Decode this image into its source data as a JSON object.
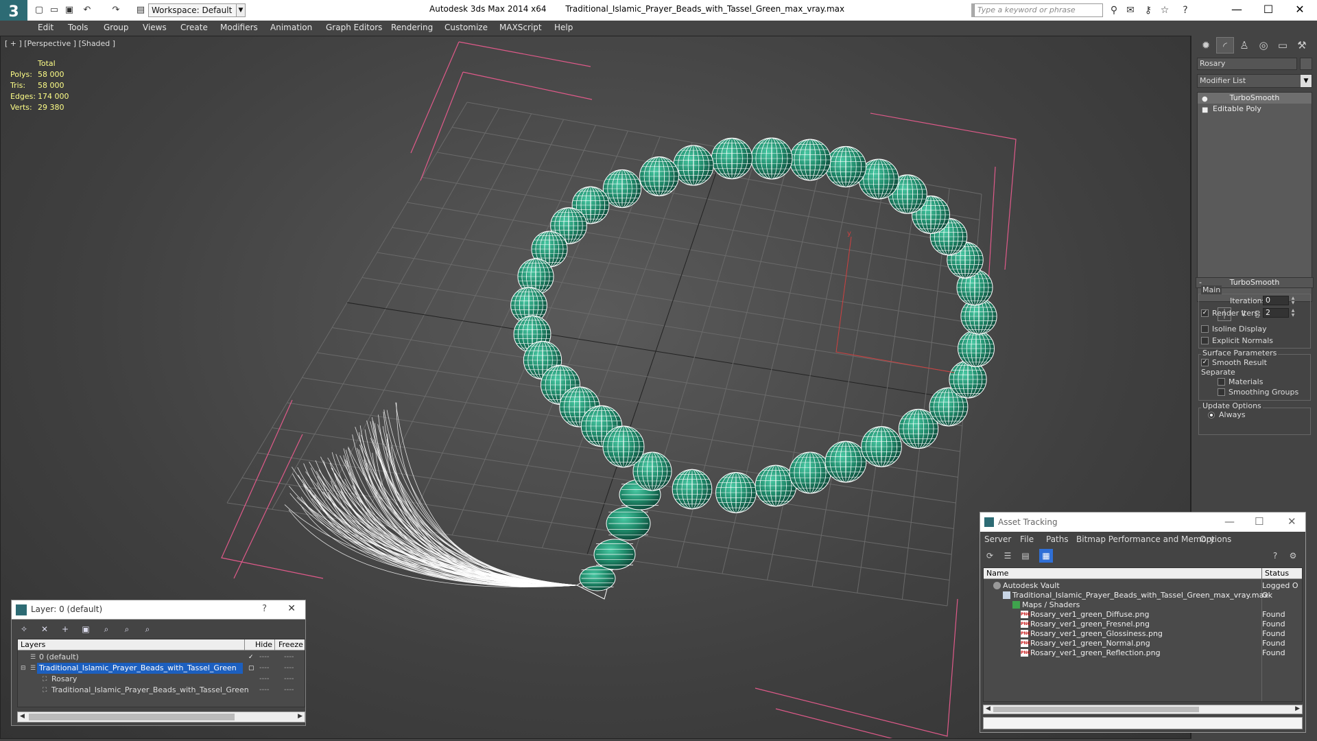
{
  "titlebar": {
    "workspace": "Workspace: Default",
    "app_name": "Autodesk 3ds Max  2014 x64",
    "file_name": "Traditional_Islamic_Prayer_Beads_with_Tassel_Green_max_vray.max",
    "search_placeholder": "Type a keyword or phrase"
  },
  "menu": [
    "Edit",
    "Tools",
    "Group",
    "Views",
    "Create",
    "Modifiers",
    "Animation",
    "Graph Editors",
    "Rendering",
    "Customize",
    "MAXScript",
    "Help"
  ],
  "viewport": {
    "label": "[ + ] [Perspective ] [Shaded ]",
    "stats": {
      "header": "Total",
      "rows": [
        {
          "k": "Polys:",
          "v": "58 000"
        },
        {
          "k": "Tris:",
          "v": "58 000"
        },
        {
          "k": "Edges:",
          "v": "174 000"
        },
        {
          "k": "Verts:",
          "v": "29 380"
        }
      ]
    }
  },
  "command_panel": {
    "object_name": "Rosary",
    "modifier_list": "Modifier List",
    "stack": [
      "TurboSmooth",
      "Editable Poly"
    ],
    "rollout_title": "TurboSmooth",
    "main_group": "Main",
    "iterations_label": "Iterations:",
    "iterations_value": "0",
    "render_iters_label": "Render Iters:",
    "render_iters_value": "2",
    "isoline_label": "Isoline Display",
    "explicit_normals_label": "Explicit Normals",
    "surface_group": "Surface Parameters",
    "smooth_result_label": "Smooth Result",
    "separate_label": "Separate",
    "materials_label": "Materials",
    "smoothing_groups_label": "Smoothing Groups",
    "update_group": "Update Options",
    "always_label": "Always"
  },
  "layer_panel": {
    "title": "Layer: 0 (default)",
    "help": "?",
    "columns": {
      "layers": "Layers",
      "hide": "Hide",
      "freeze": "Freeze"
    },
    "rows": [
      {
        "name": "0 (default)"
      },
      {
        "name": "Traditional_Islamic_Prayer_Beads_with_Tassel_Green"
      },
      {
        "name": "Rosary"
      },
      {
        "name": "Traditional_Islamic_Prayer_Beads_with_Tassel_Green"
      }
    ],
    "dash": "----"
  },
  "asset_panel": {
    "title": "Asset Tracking",
    "menu": [
      "Server",
      "File",
      "Paths",
      "Bitmap Performance and Memory",
      "Options"
    ],
    "columns": {
      "name": "Name",
      "status": "Status"
    },
    "rows": [
      {
        "name": "Autodesk Vault",
        "status": "Logged O"
      },
      {
        "name": "Traditional_Islamic_Prayer_Beads_with_Tassel_Green_max_vray.max",
        "status": "Ok"
      },
      {
        "name": "Maps / Shaders",
        "status": ""
      },
      {
        "name": "Rosary_ver1_green_Diffuse.png",
        "status": "Found"
      },
      {
        "name": "Rosary_ver1_green_Fresnel.png",
        "status": "Found"
      },
      {
        "name": "Rosary_ver1_green_Glossiness.png",
        "status": "Found"
      },
      {
        "name": "Rosary_ver1_green_Normal.png",
        "status": "Found"
      },
      {
        "name": "Rosary_ver1_green_Reflection.png",
        "status": "Found"
      }
    ]
  },
  "colors": {
    "bead": "#1f8a6a",
    "bead_highlight": "#49c9a4",
    "wire": "#ffffff",
    "bbox": "#e05a8a",
    "selection": "#1c5fbf",
    "stats": "#ffff88"
  }
}
